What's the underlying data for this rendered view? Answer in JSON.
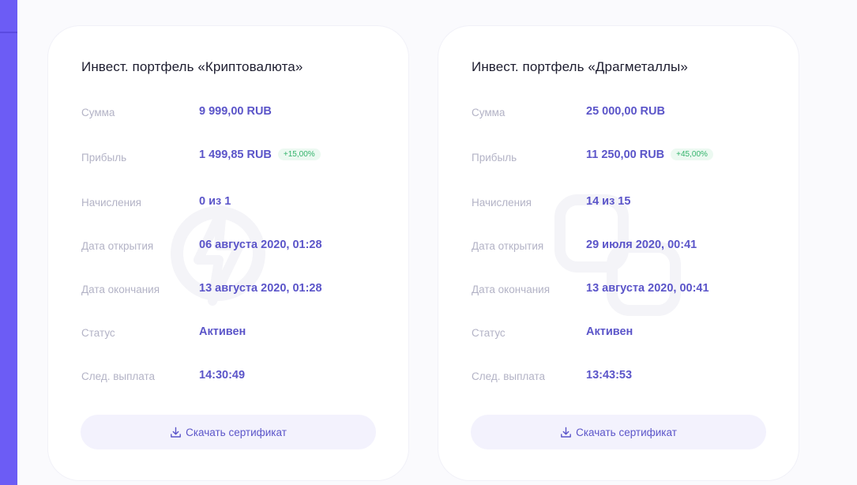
{
  "cards": [
    {
      "title": "Инвест. портфель «Криптовалюта»",
      "rows": [
        {
          "label": "Сумма",
          "value": "9 999,00 RUB"
        },
        {
          "label": "Прибыль",
          "value": "1 499,85 RUB",
          "badge": "+15,00%"
        },
        {
          "label": "Начисления",
          "value": "0 из 1"
        },
        {
          "label": "Дата открытия",
          "value": "06 августа 2020, 01:28"
        },
        {
          "label": "Дата окончания",
          "value": "13 августа 2020, 01:28"
        },
        {
          "label": "Статус",
          "value": "Активен"
        },
        {
          "label": "След. выплата",
          "value": "14:30:49"
        }
      ],
      "button_label": "Скачать сертификат",
      "watermark_icon": "lightning-icon"
    },
    {
      "title": "Инвест. портфель «Драгметаллы»",
      "rows": [
        {
          "label": "Сумма",
          "value": "25 000,00 RUB"
        },
        {
          "label": "Прибыль",
          "value": "11 250,00 RUB",
          "badge": "+45,00%"
        },
        {
          "label": "Начисления",
          "value": "14 из 15"
        },
        {
          "label": "Дата открытия",
          "value": "29 июля 2020, 00:41"
        },
        {
          "label": "Дата окончания",
          "value": "13 августа 2020, 00:41"
        },
        {
          "label": "Статус",
          "value": "Активен"
        },
        {
          "label": "След. выплата",
          "value": "13:43:53"
        }
      ],
      "button_label": "Скачать сертификат",
      "watermark_icon": "gold-bars-icon"
    }
  ],
  "colors": {
    "accent": "#5b55c9",
    "sidebar": "#6c5cf5",
    "badge_text": "#33b36b",
    "label": "#b3b3c6"
  }
}
